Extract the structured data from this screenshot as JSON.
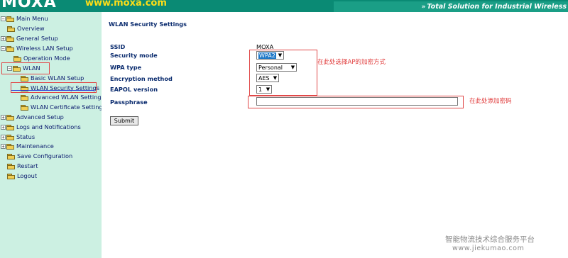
{
  "header": {
    "logo": "MOXA",
    "url": "www.moxa.com",
    "tagline": "Total Solution for Industrial Wireless",
    "colors": {
      "banner": "#0a8a74",
      "url": "#ffde17"
    }
  },
  "sidebar": {
    "items": [
      {
        "label": "Main Menu",
        "expander": "−",
        "icon": "folder-icon"
      },
      {
        "label": "Overview",
        "expander": "",
        "icon": "folder-icon"
      },
      {
        "label": "General Setup",
        "expander": "+",
        "icon": "folder-icon"
      },
      {
        "label": "Wireless LAN Setup",
        "expander": "−",
        "icon": "folder-icon"
      },
      {
        "label": "Operation Mode",
        "expander": "",
        "icon": "folder-icon"
      },
      {
        "label": "WLAN",
        "expander": "−",
        "icon": "folder-icon"
      },
      {
        "label": "Basic WLAN Setup",
        "expander": "",
        "icon": "folder-icon"
      },
      {
        "label": "WLAN Security Settings",
        "expander": "",
        "icon": "folder-icon"
      },
      {
        "label": "Advanced WLAN Settings",
        "expander": "",
        "icon": "folder-icon"
      },
      {
        "label": "WLAN Certificate Settings",
        "expander": "",
        "icon": "folder-icon"
      },
      {
        "label": "Advanced Setup",
        "expander": "+",
        "icon": "folder-icon"
      },
      {
        "label": "Logs and Notifications",
        "expander": "+",
        "icon": "folder-icon"
      },
      {
        "label": "Status",
        "expander": "+",
        "icon": "folder-icon"
      },
      {
        "label": "Maintenance",
        "expander": "+",
        "icon": "folder-icon"
      },
      {
        "label": "Save Configuration",
        "expander": "",
        "icon": "folder-icon"
      },
      {
        "label": "Restart",
        "expander": "",
        "icon": "folder-icon"
      },
      {
        "label": "Logout",
        "expander": "",
        "icon": "folder-icon"
      }
    ]
  },
  "main": {
    "title": "WLAN Security Settings",
    "fields": {
      "ssid": {
        "label": "SSID",
        "value": "MOXA"
      },
      "security_mode": {
        "label": "Security mode",
        "value": "WPA2"
      },
      "wpa_type": {
        "label": "WPA type",
        "value": "Personal"
      },
      "encryption_method": {
        "label": "Encryption method",
        "value": "AES"
      },
      "eapol_version": {
        "label": "EAPOL version",
        "value": "1"
      },
      "passphrase": {
        "label": "Passphrase",
        "value": ""
      }
    },
    "submit_label": "Submit"
  },
  "annotations": {
    "security_note": "在此处选择AP的加密方式",
    "passphrase_note": "在此处添加密码",
    "color": "#e04848"
  },
  "watermark": {
    "line1": "智能物流技术综合服务平台",
    "line2": "www.jiekumao.com"
  }
}
